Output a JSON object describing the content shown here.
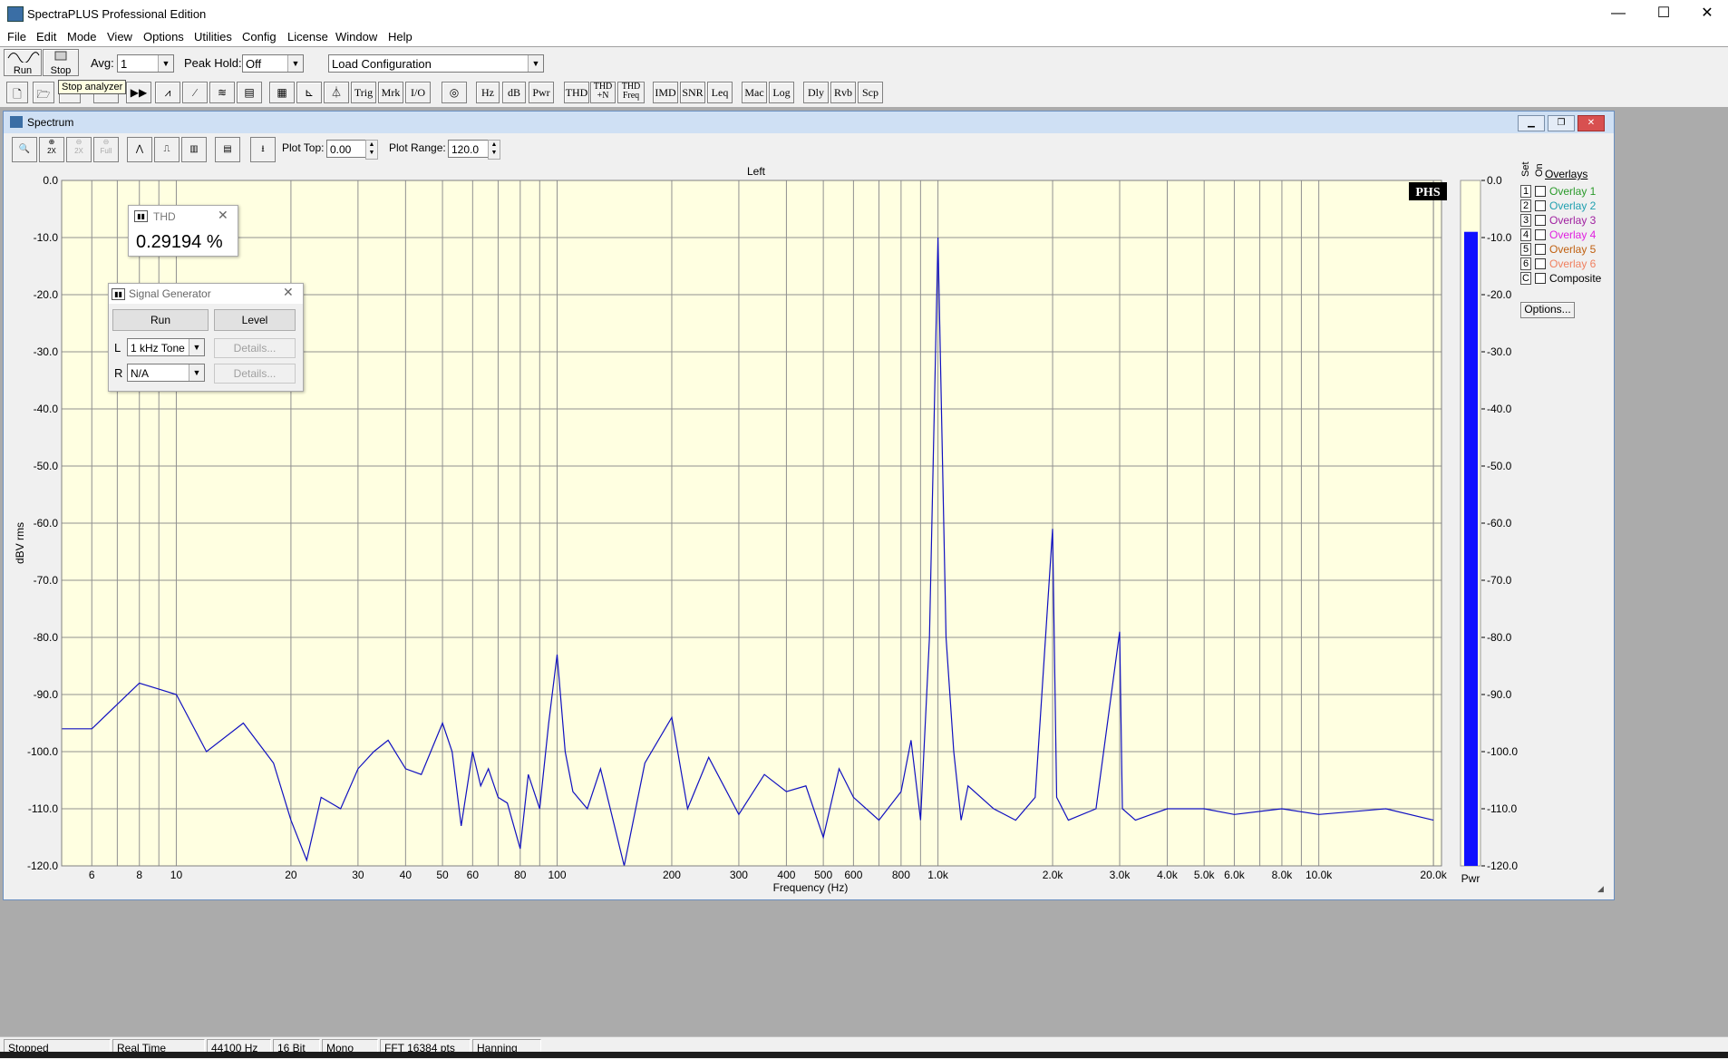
{
  "app": {
    "title": "SpectraPLUS Professional Edition",
    "window_controls": {
      "minimize": "—",
      "maximize": "☐",
      "close": "✕"
    }
  },
  "menu": [
    "File",
    "Edit",
    "Mode",
    "View",
    "Options",
    "Utilities",
    "Config",
    "License",
    "Window",
    "Help"
  ],
  "toolbar1": {
    "run_label": "Run",
    "stop_label": "Stop",
    "avg_label": "Avg:",
    "avg_value": "1",
    "peak_hold_label": "Peak Hold:",
    "peak_hold_value": "Off",
    "load_config_value": "Load Configuration"
  },
  "tooltip": "Stop analyzer",
  "toolbar2": {
    "text_buttons": [
      "Trig",
      "Mrk",
      "I/O",
      "Hz",
      "dB",
      "Pwr",
      "THD",
      "THD\n+N",
      "THD\nFreq",
      "IMD",
      "SNR",
      "Leq",
      "Mac",
      "Log",
      "Dly",
      "Rvb",
      "Scp"
    ]
  },
  "spectrum_window": {
    "title": "Spectrum",
    "plot_top_label": "Plot Top:",
    "plot_top_value": "0.00",
    "plot_range_label": "Plot Range:",
    "plot_range_value": "120.0",
    "channel_label": "Left",
    "logo": "PHS"
  },
  "thd_window": {
    "title": "THD",
    "value": "0.29194 %"
  },
  "signal_generator": {
    "title": "Signal Generator",
    "run_label": "Run",
    "level_label": "Level",
    "l_label": "L",
    "l_value": "1 kHz Tone",
    "r_label": "R",
    "r_value": "N/A",
    "details_label": "Details..."
  },
  "overlays": {
    "title": "Overlays",
    "set_header": "Set",
    "on_header": "On",
    "items": [
      {
        "num": "1",
        "label": "Overlay 1",
        "color": "#2a9a2a"
      },
      {
        "num": "2",
        "label": "Overlay 2",
        "color": "#20a0b0"
      },
      {
        "num": "3",
        "label": "Overlay 3",
        "color": "#a020a0"
      },
      {
        "num": "4",
        "label": "Overlay 4",
        "color": "#e020e0"
      },
      {
        "num": "5",
        "label": "Overlay 5",
        "color": "#c06010"
      },
      {
        "num": "6",
        "label": "Overlay 6",
        "color": "#f08060"
      },
      {
        "num": "C",
        "label": "Composite",
        "color": "#000000"
      }
    ],
    "options_label": "Options..."
  },
  "status": [
    "Stopped",
    "Real Time",
    "44100 Hz",
    "16 Bit",
    "Mono",
    "FFT 16384 pts",
    "Hanning"
  ],
  "chart_data": {
    "type": "line",
    "title": "Left",
    "xlabel": "Frequency (Hz)",
    "ylabel": "dBV rms",
    "x_scale": "log",
    "xlim": [
      5,
      21000
    ],
    "ylim": [
      -120,
      0
    ],
    "x_ticks": [
      6,
      8,
      10,
      20,
      30,
      40,
      50,
      60,
      80,
      100,
      200,
      300,
      400,
      500,
      600,
      800,
      1000,
      2000,
      3000,
      4000,
      5000,
      6000,
      8000,
      10000,
      20000
    ],
    "x_tick_labels": [
      "6",
      "8",
      "10",
      "20",
      "30",
      "40",
      "50",
      "60",
      "80",
      "100",
      "200",
      "300",
      "400",
      "500",
      "600",
      "800",
      "1.0k",
      "2.0k",
      "3.0k",
      "4.0k",
      "5.0k",
      "6.0k",
      "8.0k",
      "10.0k",
      "20.0k"
    ],
    "y_ticks": [
      0,
      -10,
      -20,
      -30,
      -40,
      -50,
      -60,
      -70,
      -80,
      -90,
      -100,
      -110,
      -120
    ],
    "y_tick_labels": [
      "0.0",
      "-10.0",
      "-20.0",
      "-30.0",
      "-40.0",
      "-50.0",
      "-60.0",
      "-70.0",
      "-80.0",
      "-90.0",
      "-100.0",
      "-110.0",
      "-120.0"
    ],
    "grid": true,
    "background": "#ffffe1",
    "line_color": "#1010c0",
    "series": [
      {
        "x": [
          5,
          6,
          8,
          10,
          12,
          15,
          18,
          20,
          22,
          24,
          27,
          30,
          33,
          36,
          40,
          44,
          50,
          53,
          56,
          60,
          63,
          66,
          70,
          74,
          80,
          84,
          90,
          95,
          100,
          105,
          110,
          120,
          130,
          150,
          170,
          200,
          220,
          250,
          300,
          350,
          400,
          450,
          500,
          550,
          600,
          700,
          800,
          850,
          900,
          950,
          1000,
          1050,
          1100,
          1150,
          1200,
          1400,
          1600,
          1800,
          2000,
          2050,
          2200,
          2600,
          3000,
          3050,
          3300,
          4000,
          5000,
          6000,
          8000,
          10000,
          15000,
          20000
        ],
        "y": [
          -96,
          -96,
          -88,
          -90,
          -100,
          -95,
          -102,
          -112,
          -119,
          -108,
          -110,
          -103,
          -100,
          -98,
          -103,
          -104,
          -95,
          -100,
          -113,
          -100,
          -106,
          -103,
          -108,
          -109,
          -117,
          -104,
          -110,
          -95,
          -83,
          -100,
          -107,
          -110,
          -103,
          -120,
          -102,
          -94,
          -110,
          -101,
          -111,
          -104,
          -107,
          -106,
          -115,
          -103,
          -108,
          -112,
          -107,
          -98,
          -112,
          -80,
          -10,
          -80,
          -100,
          -112,
          -106,
          -110,
          -112,
          -108,
          -61,
          -108,
          -112,
          -110,
          -79,
          -110,
          -112,
          -110,
          -110,
          -111,
          -110,
          -111,
          -110,
          -112
        ]
      }
    ],
    "level_meter": {
      "label": "Pwr",
      "value": -9,
      "ylim": [
        -120,
        0
      ]
    }
  }
}
